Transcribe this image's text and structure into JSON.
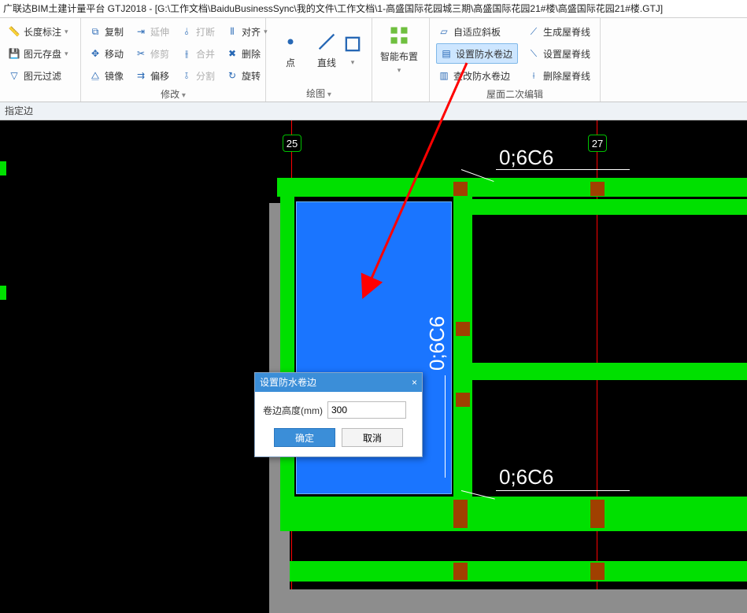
{
  "title": "广联达BIM土建计量平台 GTJ2018 - [G:\\工作文档\\BaiduBusinessSync\\我的文件\\工作文档\\1-高盛国际花园城三期\\高盛国际花园21#楼\\高盛国际花园21#楼.GTJ]",
  "ribbon": {
    "g1": {
      "dim": "长度标注",
      "save": "图元存盘",
      "filter": "图元过滤"
    },
    "g2": {
      "copy": "复制",
      "move": "移动",
      "mirror": "镜像",
      "extend": "延伸",
      "trim": "修剪",
      "offset": "偏移",
      "break": "打断",
      "merge": "合并",
      "split": "分割",
      "align": "对齐",
      "delete": "删除",
      "rotate": "旋转",
      "label": "修改"
    },
    "g3": {
      "point": "点",
      "line": "直线",
      "more": "",
      "label": "绘图"
    },
    "g4": {
      "smart": "智能布置"
    },
    "g5": {
      "auto": "自适应斜板",
      "setwp": "设置防水卷边",
      "chkwp": "查改防水卷边",
      "gen": "生成屋脊线",
      "set": "设置屋脊线",
      "del": "删除屋脊线",
      "label": "屋面二次编辑"
    }
  },
  "status": "指定边",
  "markers": {
    "m1": "25",
    "m2": "27"
  },
  "labels": {
    "l1": "0;6C6",
    "l2": "0;6C6",
    "l3": "0;6C6"
  },
  "dialog": {
    "title": "设置防水卷边",
    "field": "卷边高度(mm)",
    "value": "300",
    "ok": "确定",
    "cancel": "取消",
    "close": "×"
  }
}
